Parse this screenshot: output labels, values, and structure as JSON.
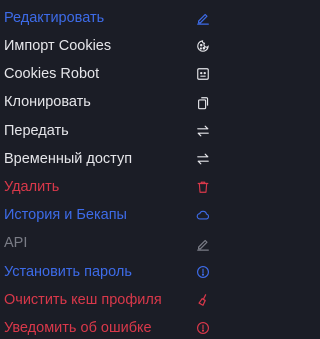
{
  "menu": {
    "items": [
      {
        "label": "Редактировать",
        "icon": "pencil-icon",
        "color": "#3d6be8"
      },
      {
        "label": "Импорт Cookies",
        "icon": "cookie-icon",
        "color": "#e6e6ea"
      },
      {
        "label": "Cookies Robot",
        "icon": "robot-icon",
        "color": "#e6e6ea"
      },
      {
        "label": "Клонировать",
        "icon": "copy-icon",
        "color": "#e6e6ea"
      },
      {
        "label": "Передать",
        "icon": "transfer-icon",
        "color": "#e6e6ea"
      },
      {
        "label": "Временный доступ",
        "icon": "temporary-transfer-icon",
        "color": "#e6e6ea"
      },
      {
        "label": "Удалить",
        "icon": "trash-icon",
        "color": "#d9384a"
      },
      {
        "label": "История и Бекапы",
        "icon": "cloud-icon",
        "color": "#3d6be8"
      },
      {
        "label": "API",
        "icon": "pencil-icon",
        "color": "#7a7c86"
      },
      {
        "label": "Установить пароль",
        "icon": "info-circle-icon",
        "color": "#3d6be8"
      },
      {
        "label": "Очистить кеш профиля",
        "icon": "broom-icon",
        "color": "#d9384a"
      },
      {
        "label": "Уведомить об ошибке",
        "icon": "alert-circle-icon",
        "color": "#d9384a"
      }
    ]
  }
}
